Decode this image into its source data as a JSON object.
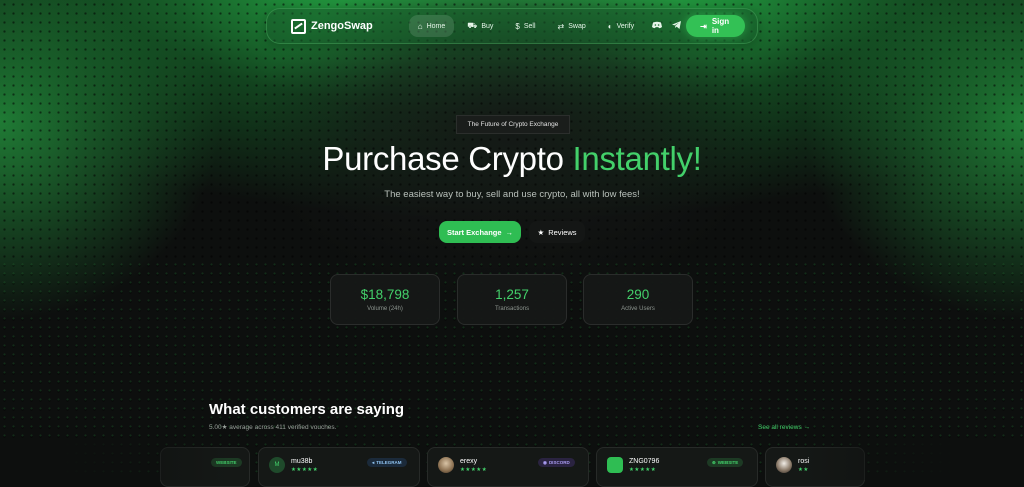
{
  "nav": {
    "brand": "ZengoSwap",
    "links": [
      {
        "label": "Home",
        "icon": "home-icon",
        "active": true
      },
      {
        "label": "Buy",
        "icon": "cart-icon"
      },
      {
        "label": "Sell",
        "icon": "dollar-icon"
      },
      {
        "label": "Swap",
        "icon": "swap-icon"
      },
      {
        "label": "Verify",
        "icon": "shield-icon"
      }
    ],
    "sign_in": "Sign in"
  },
  "hero": {
    "pill": "The Future of Crypto Exchange",
    "headline_white": "Purchase Crypto ",
    "headline_green": "Instantly!",
    "subline": "The easiest way to buy, sell and use crypto, all with low fees!",
    "cta_primary": "Start Exchange",
    "cta_secondary": "Reviews"
  },
  "stats": [
    {
      "value": "$18,798",
      "label": "Volume (24h)"
    },
    {
      "value": "1,257",
      "label": "Transactions"
    },
    {
      "value": "290",
      "label": "Active Users"
    }
  ],
  "testimonials": {
    "title": "What customers are saying",
    "subtitle": "5.00★ average across 411 verified vouches.",
    "see_all": "See all reviews",
    "cards": [
      {
        "name": "",
        "badge": "WEBSITE",
        "stars": "★★★★★"
      },
      {
        "name": "mu38b",
        "initial": "M",
        "badge": "TELEGRAM",
        "stars": "★★★★★"
      },
      {
        "name": "erexy",
        "badge": "DISCORD",
        "stars": "★★★★★"
      },
      {
        "name": "ZNG0796",
        "badge": "WEBSITE",
        "stars": "★★★★★"
      },
      {
        "name": "rosi",
        "badge": "",
        "stars": "★★"
      }
    ]
  },
  "colors": {
    "accent": "#43d06a",
    "button": "#2fbd53",
    "background": "#0d0f0e"
  }
}
